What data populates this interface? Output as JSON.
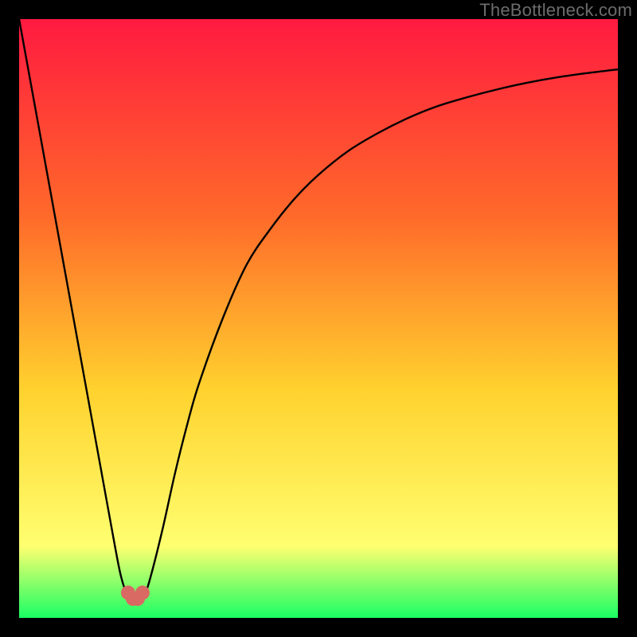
{
  "watermark": "TheBottleneck.com",
  "colors": {
    "frame": "#000000",
    "gradient_top": "#ff1a40",
    "gradient_mid1": "#ff6a2a",
    "gradient_mid2": "#ffd22e",
    "gradient_mid3": "#ffff70",
    "gradient_bottom": "#19ff64",
    "curve": "#000000",
    "marker": "#d96a63"
  },
  "chart_data": {
    "type": "line",
    "title": "",
    "xlabel": "",
    "ylabel": "",
    "xlim": [
      0,
      100
    ],
    "ylim": [
      0,
      100
    ],
    "series": [
      {
        "name": "bottleneck-curve",
        "x": [
          0,
          2,
          4,
          6,
          8,
          10,
          12,
          14,
          16,
          17,
          18,
          19,
          20,
          21,
          22,
          24,
          26,
          28,
          30,
          34,
          38,
          42,
          46,
          50,
          55,
          60,
          65,
          70,
          75,
          80,
          85,
          90,
          95,
          100
        ],
        "y": [
          100,
          89,
          78,
          67,
          56,
          45,
          34,
          23,
          12,
          7,
          4,
          3,
          3,
          4,
          7,
          15,
          24,
          32,
          39,
          50,
          59,
          65,
          70,
          74,
          78,
          81,
          83.5,
          85.5,
          87,
          88.3,
          89.4,
          90.3,
          91,
          91.6
        ]
      }
    ],
    "markers": [
      {
        "x": 18.2,
        "y": 4.2
      },
      {
        "x": 19.0,
        "y": 3.2
      },
      {
        "x": 19.8,
        "y": 3.2
      },
      {
        "x": 20.6,
        "y": 4.2
      }
    ]
  }
}
